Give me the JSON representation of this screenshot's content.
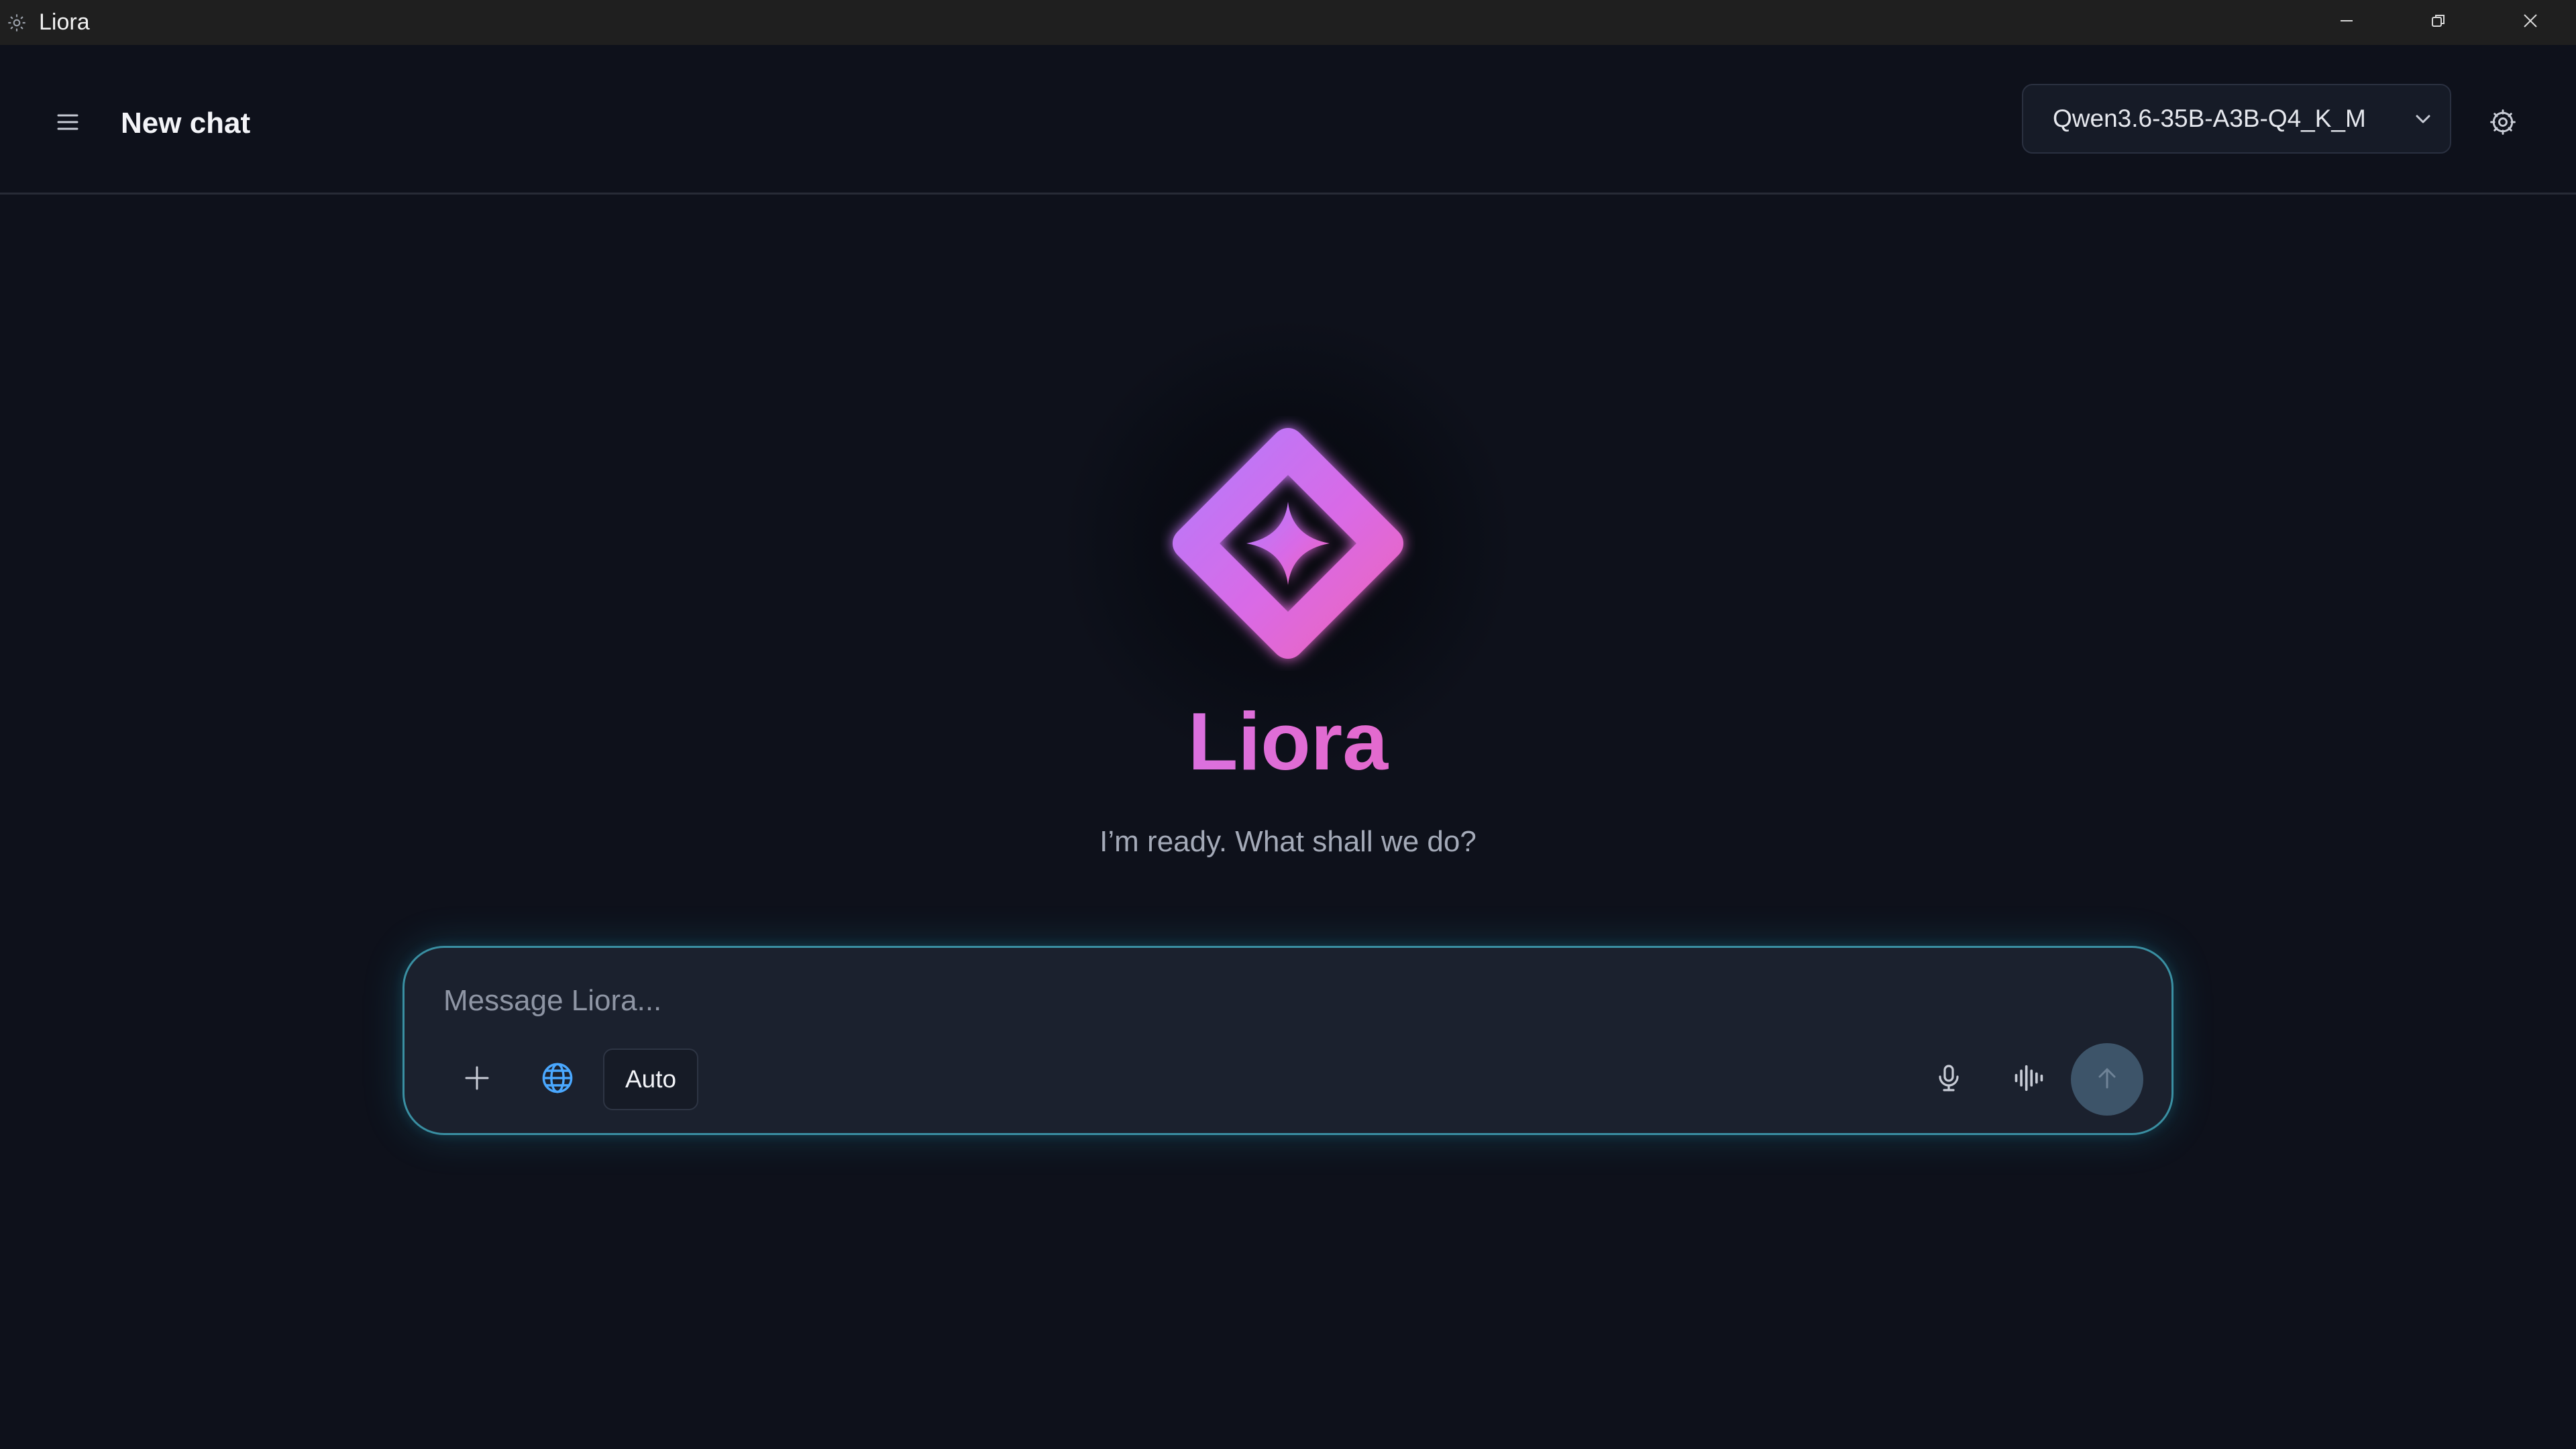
{
  "window": {
    "title": "Liora",
    "icons": {
      "app": "gear-app-icon",
      "minimize": "minimize-icon",
      "maximize": "restore-icon",
      "close": "close-icon"
    }
  },
  "header": {
    "title": "New chat",
    "menu_icon": "hamburger-menu-icon",
    "model": {
      "selected": "Qwen3.6-35B-A3B-Q4_K_M",
      "icon": "chevron-down-icon"
    },
    "settings_icon": "gear-icon"
  },
  "hero": {
    "brand": "Liora",
    "tagline": "I’m ready. What shall we do?",
    "logo_icon": "diamond-sparkle-logo"
  },
  "composer": {
    "placeholder": "Message Liora...",
    "value": "",
    "mode_label": "Auto",
    "icons": {
      "add": "plus-icon",
      "web": "globe-icon",
      "mic": "microphone-icon",
      "voice": "audio-waveform-icon",
      "send": "arrow-up-icon"
    }
  },
  "colors": {
    "background": "#0e111b",
    "titlebar": "#1f1f1f",
    "accent_cyan": "#3a8fa2",
    "brand_violet": "#c77dff",
    "brand_pink": "#f062c0",
    "globe_blue": "#4aa8ff",
    "send_button": "#3d5469"
  }
}
